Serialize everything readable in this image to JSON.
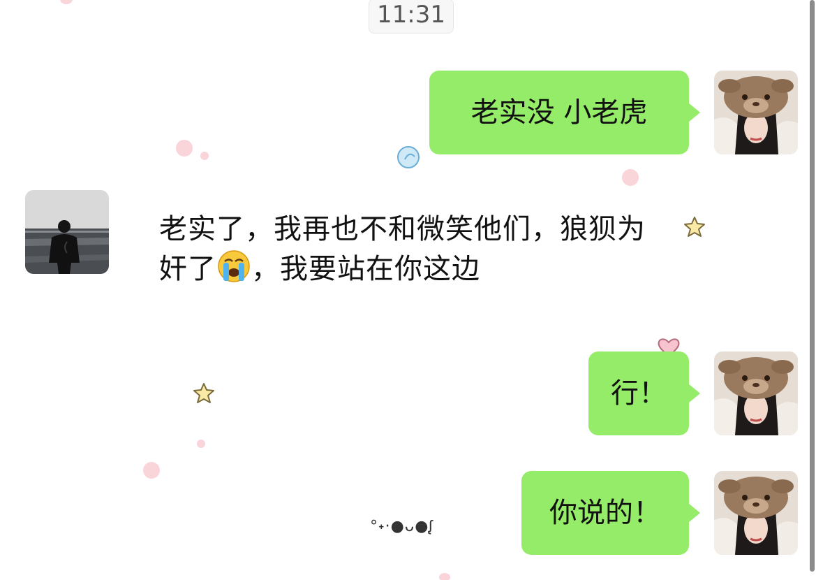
{
  "timestamp": "11:31",
  "messages": [
    {
      "direction": "out",
      "text": "老实没 小老虎"
    },
    {
      "direction": "in",
      "text_before_emoji": "老实了，我再也不和微笑他们，狼狈为奸了",
      "emoji": "loudly-crying-face",
      "text_after_emoji": "，我要站在你这边"
    },
    {
      "direction": "out",
      "text": "行！"
    },
    {
      "direction": "out",
      "text": "你说的！"
    }
  ],
  "decorations": {
    "kaomoji": "°˖·●ᴗ●ᶘ",
    "icons": [
      "star-icon",
      "heart-icon",
      "cloud-icon"
    ]
  },
  "colors": {
    "outgoing_bubble": "#95ec69",
    "background": "#ffffff",
    "timestamp_bg": "#f7f7f7"
  }
}
